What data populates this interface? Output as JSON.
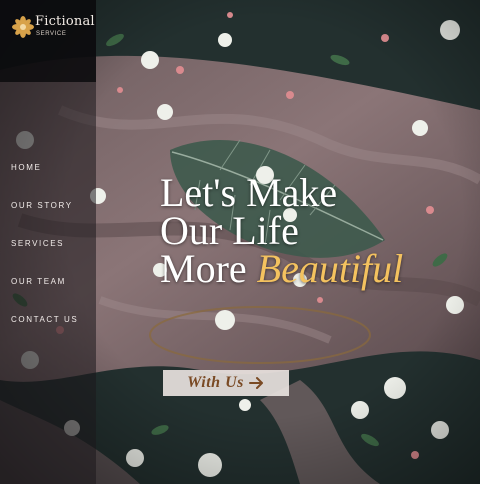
{
  "brand": {
    "name": "Fictional",
    "tagline": "SERVICE",
    "logo_icon": "flower-logo-icon"
  },
  "nav": {
    "items": [
      {
        "label": "HOME"
      },
      {
        "label": "OUR STORY"
      },
      {
        "label": "SERVICES"
      },
      {
        "label": "OUR TEAM"
      },
      {
        "label": "CONTACT US"
      }
    ]
  },
  "hero": {
    "line1": "Let's Make",
    "line2": "Our Life",
    "line3_plain": "More",
    "line3_accent": "Beautiful",
    "cta_label": "With Us",
    "cta_icon": "arrow-right-icon"
  },
  "colors": {
    "accent": "#f4c25f",
    "cta_text": "#7a4a24",
    "fabric": "#7e6a6a",
    "dark_background": "#1e2a2a"
  }
}
